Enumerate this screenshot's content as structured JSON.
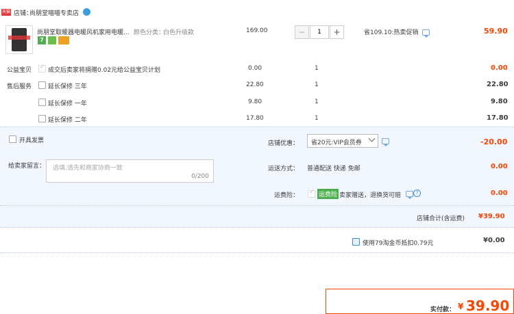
{
  "shop": {
    "badge": "天猫",
    "label_prefix": "店铺：",
    "name": "尚朋堂喵喵专卖店"
  },
  "product": {
    "title": "尚朋堂取暖器电暖风机家用电暖...",
    "variant_label": "颜色分类：",
    "variant_value": "白色升级款",
    "unit_price": "169.00",
    "quantity": "1",
    "promo": "省109.10:热卖促销",
    "total": "59.90",
    "badge_7": "7"
  },
  "charity": {
    "label": "公益宝贝",
    "text": "成交后卖家将捐赠0.02元给公益宝贝计划",
    "price": "0.00",
    "qty": "1",
    "total": "0.00"
  },
  "after_sale": {
    "label": "售后服务",
    "options": [
      {
        "name": "延长保修 三年",
        "price": "22.80",
        "qty": "1",
        "total": "22.80"
      },
      {
        "name": "延长保修 一年",
        "price": "9.80",
        "qty": "1",
        "total": "9.80"
      },
      {
        "name": "延长保修 二年",
        "price": "17.80",
        "qty": "1",
        "total": "17.80"
      }
    ]
  },
  "invoice": {
    "label": "开具发票"
  },
  "message": {
    "label": "给卖家留言：",
    "placeholder": "选填,请先和商家协商一致",
    "counter": "0/200"
  },
  "shop_discount": {
    "label": "店铺优惠：",
    "selected": "省20元:VIP会员券",
    "amount": "-20.00"
  },
  "shipping": {
    "label": "运送方式：",
    "method": "普通配送 快递 免邮",
    "amount": "0.00"
  },
  "insurance": {
    "label": "运费险：",
    "badge": "运费险",
    "text": "卖家赠送，退换货可赔",
    "amount": "0.00"
  },
  "shop_total": {
    "label": "店铺合计(含运费)",
    "amount": "¥39.90"
  },
  "coins": {
    "text": "使用79淘金币抵扣0.79元",
    "amount": "¥0.00"
  },
  "payment": {
    "label": "实付款：",
    "currency": "¥",
    "amount": "39.90"
  },
  "colors": {
    "accent_red": "#ff4400",
    "row_bg": "#f2f7ff",
    "link_blue": "#3c8dd3"
  }
}
